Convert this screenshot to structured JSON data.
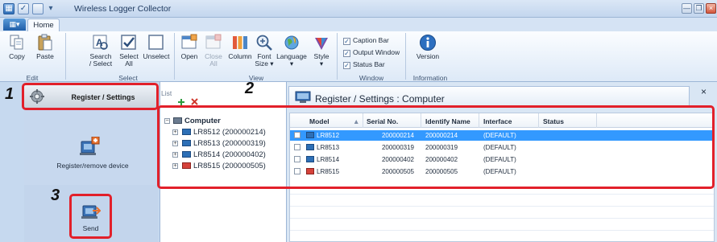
{
  "window": {
    "title": "Wireless Logger Collector",
    "controls": [
      "minimize",
      "restore",
      "close"
    ]
  },
  "tabs": {
    "file_menu": "▾",
    "home": "Home"
  },
  "ribbon": {
    "groups": [
      {
        "label": "Edit",
        "buttons": [
          {
            "label": "Copy"
          },
          {
            "label": "Paste"
          }
        ]
      },
      {
        "label": "Select",
        "buttons": [
          {
            "label": "Search / Select"
          },
          {
            "label": "Select All"
          },
          {
            "label": "Unselect"
          }
        ]
      },
      {
        "label": "View",
        "buttons": [
          {
            "label": "Open"
          },
          {
            "label": "Close All"
          },
          {
            "label": "Column"
          },
          {
            "label": "Font Size"
          },
          {
            "label": "Language"
          },
          {
            "label": "Style"
          }
        ]
      },
      {
        "label": "Window",
        "checks": [
          "Caption Bar",
          "Output Window",
          "Status Bar"
        ]
      },
      {
        "label": "Information",
        "buttons": [
          {
            "label": "Version"
          }
        ]
      }
    ],
    "labels": {
      "copy": "Copy",
      "paste": "Paste",
      "search1": "Search",
      "search2": "/ Select",
      "selectall1": "Select",
      "selectall2": "All",
      "unselect": "Unselect",
      "open": "Open",
      "closeall1": "Close",
      "closeall2": "All",
      "column": "Column",
      "fontsize1": "Font",
      "fontsize2": "Size ▾",
      "language1": "Language",
      "language2": "▾",
      "style1": "Style",
      "style2": "▾",
      "version": "Version"
    },
    "group_labels": {
      "edit": "Edit",
      "select": "Select",
      "view": "View",
      "window": "Window",
      "information": "Information"
    },
    "checks": {
      "caption_bar": "Caption Bar",
      "output_window": "Output Window",
      "status_bar": "Status Bar"
    }
  },
  "leftnav": {
    "header": "Register / Settings",
    "item1": "Register/remove device",
    "item2": "Send"
  },
  "list": {
    "title": "List",
    "tree_root": "Computer",
    "tree_items": [
      "LR8512 (200000214)",
      "LR8513 (200000319)",
      "LR8514 (200000402)",
      "LR8515 (200000505)"
    ]
  },
  "main": {
    "header": "Register / Settings : Computer",
    "close": "×",
    "columns": {
      "model": "Model",
      "serial": "Serial No.",
      "identify": "Identify Name",
      "interface": "Interface",
      "status": "Status"
    },
    "sort_indicator": "▲",
    "rows": [
      {
        "model": "LR8512",
        "serial": "200000214",
        "identify": "200000214",
        "interface": "(DEFAULT)",
        "status": "",
        "selected": true
      },
      {
        "model": "LR8513",
        "serial": "200000319",
        "identify": "200000319",
        "interface": "(DEFAULT)",
        "status": ""
      },
      {
        "model": "LR8514",
        "serial": "200000402",
        "identify": "200000402",
        "interface": "(DEFAULT)",
        "status": ""
      },
      {
        "model": "LR8515",
        "serial": "200000505",
        "identify": "200000505",
        "interface": "(DEFAULT)",
        "status": ""
      }
    ]
  },
  "annotations": {
    "n1": "1",
    "n2": "2",
    "n3": "3"
  },
  "colors": {
    "highlight": "#e2202a",
    "selection": "#3399ff",
    "ribbon_bg": "#dde9f7",
    "nav_bg": "#c6d9ef"
  }
}
